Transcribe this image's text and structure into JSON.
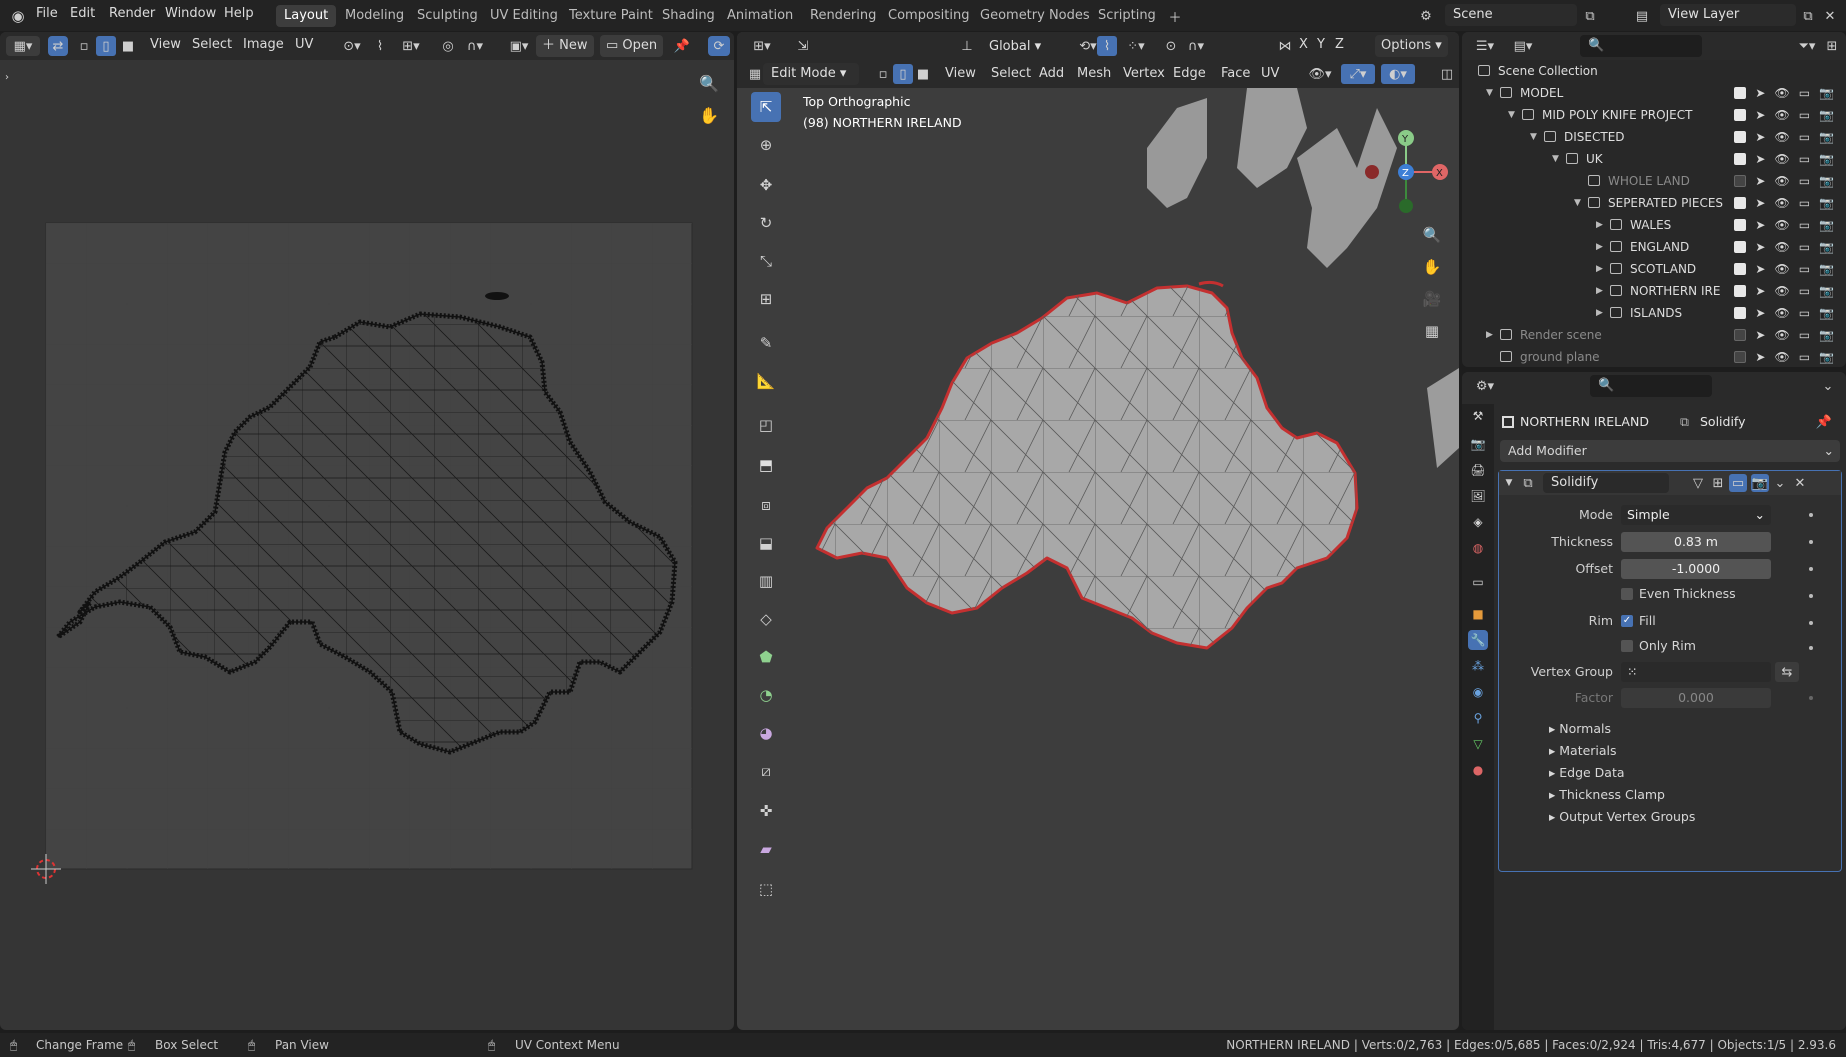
{
  "topbar": {
    "menus": [
      "File",
      "Edit",
      "Render",
      "Window",
      "Help"
    ],
    "workspaces": [
      "Layout",
      "Modeling",
      "Sculpting",
      "UV Editing",
      "Texture Paint",
      "Shading",
      "Animation",
      "Rendering",
      "Compositing",
      "Geometry Nodes",
      "Scripting"
    ],
    "active_workspace": "Layout",
    "scene": "Scene",
    "view_layer": "View Layer"
  },
  "uv_editor": {
    "menus": [
      "View",
      "Select",
      "Image",
      "UV"
    ],
    "new_label": "New",
    "open_label": "Open"
  },
  "viewport": {
    "mode": "Edit Mode",
    "menus": [
      "View",
      "Select",
      "Add",
      "Mesh",
      "Vertex",
      "Edge",
      "Face",
      "UV"
    ],
    "orientation": "Global",
    "axes": [
      "X",
      "Y",
      "Z"
    ],
    "options_label": "Options",
    "overlay_title": "Top Orthographic",
    "overlay_object": "(98) NORTHERN IRELAND"
  },
  "outliner": {
    "rows": [
      {
        "label": "Scene Collection",
        "indent": 0,
        "tri": "",
        "checked": null
      },
      {
        "label": "MODEL",
        "indent": 1,
        "tri": "▼",
        "checked": true
      },
      {
        "label": "MID POLY KNIFE PROJECT",
        "indent": 2,
        "tri": "▼",
        "checked": true
      },
      {
        "label": "DISECTED",
        "indent": 3,
        "tri": "▼",
        "checked": true
      },
      {
        "label": "UK",
        "indent": 4,
        "tri": "▼",
        "checked": true
      },
      {
        "label": "WHOLE LAND",
        "indent": 5,
        "tri": "",
        "checked": false
      },
      {
        "label": "SEPERATED PIECES",
        "indent": 5,
        "tri": "▼",
        "checked": true
      },
      {
        "label": "WALES",
        "indent": 6,
        "tri": "▶",
        "checked": true
      },
      {
        "label": "ENGLAND",
        "indent": 6,
        "tri": "▶",
        "checked": true
      },
      {
        "label": "SCOTLAND",
        "indent": 6,
        "tri": "▶",
        "checked": true
      },
      {
        "label": "NORTHERN IRE",
        "indent": 6,
        "tri": "▶",
        "checked": true
      },
      {
        "label": "ISLANDS",
        "indent": 6,
        "tri": "▶",
        "checked": true
      },
      {
        "label": "Render scene",
        "indent": 1,
        "tri": "▶",
        "checked": false
      },
      {
        "label": "ground plane",
        "indent": 1,
        "tri": "",
        "checked": false
      }
    ]
  },
  "properties": {
    "object_name": "NORTHERN IRELAND",
    "modifier_header": "Solidify",
    "add_modifier": "Add Modifier",
    "modifier_name": "Solidify",
    "mode_label": "Mode",
    "mode_value": "Simple",
    "thickness_label": "Thickness",
    "thickness_value": "0.83 m",
    "offset_label": "Offset",
    "offset_value": "-1.0000",
    "even_thickness": "Even Thickness",
    "rim_label": "Rim",
    "fill_label": "Fill",
    "only_rim": "Only Rim",
    "vertex_group_label": "Vertex Group",
    "factor_label": "Factor",
    "factor_value": "0.000",
    "sections": [
      "Normals",
      "Materials",
      "Edge Data",
      "Thickness Clamp",
      "Output Vertex Groups"
    ]
  },
  "status": {
    "change_frame": "Change Frame",
    "box_select": "Box Select",
    "pan_view": "Pan View",
    "uv_context": "UV Context Menu",
    "stats": "NORTHERN IRELAND | Verts:0/2,763 | Edges:0/5,685 | Faces:0/2,924 | Tris:4,677 | Objects:1/5 | 2.93.6"
  },
  "colors": {
    "accent": "#4772b3",
    "selected_outline": "#d22a2a",
    "mesh_fill": "#a8a8a8"
  }
}
